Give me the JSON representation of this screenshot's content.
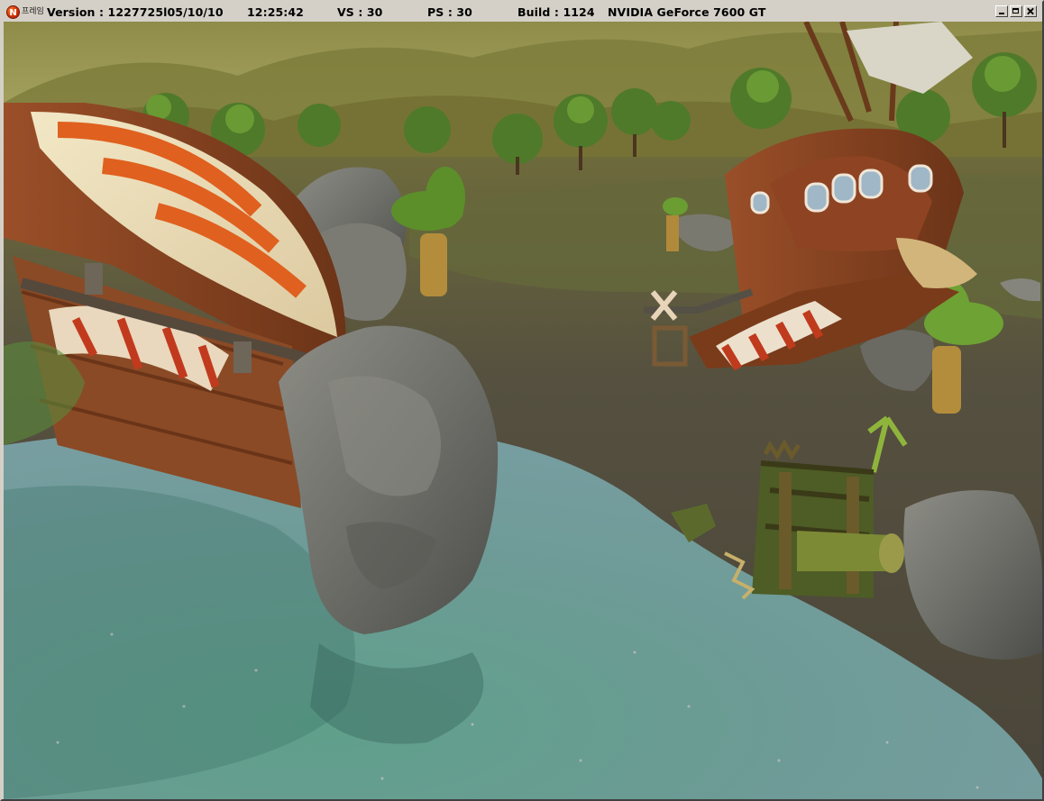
{
  "window": {
    "app_icon_letter": "N",
    "app_name": "프레임",
    "version": "Version : 1227725l05/10/10",
    "time": "12:25:42",
    "vs": "VS : 30",
    "ps": "PS : 30",
    "build": "Build : 1124",
    "gpu": "NVIDIA GeForce 7600 GT"
  },
  "colors": {
    "sky_haze": "#a9a66a",
    "water": "#6f9e95",
    "ground": "#4f4a3c",
    "sail_orange": "#e0601f",
    "wood": "#8a4a26"
  }
}
